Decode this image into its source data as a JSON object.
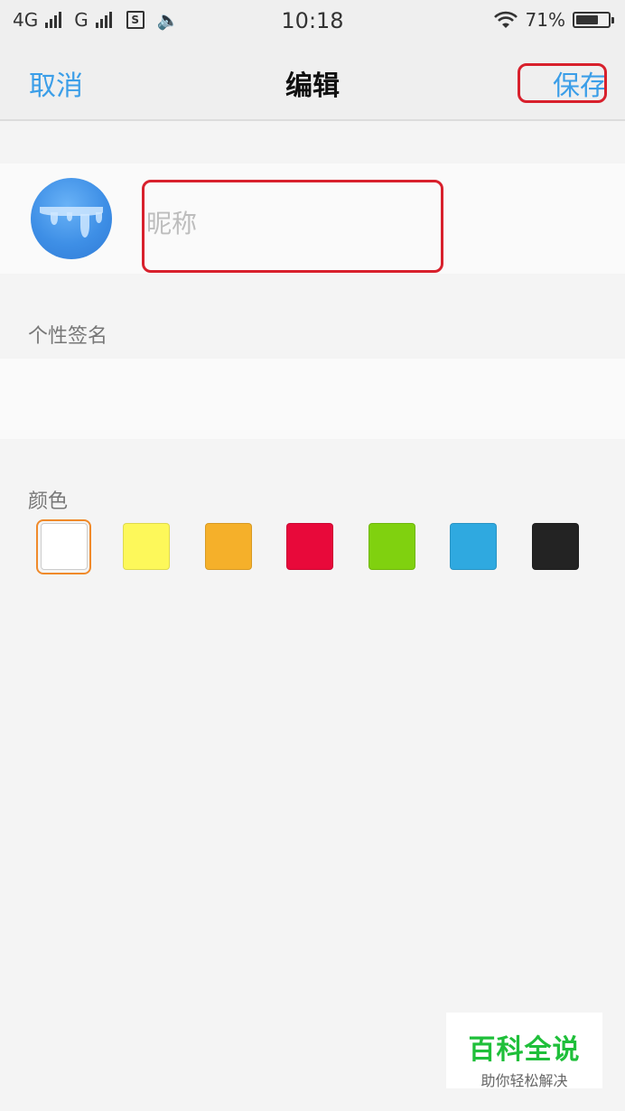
{
  "status_bar": {
    "network1": "4G",
    "network2": "G",
    "time": "10:18",
    "battery_percent": "71%",
    "battery_level": 0.71
  },
  "nav": {
    "cancel_label": "取消",
    "title": "编辑",
    "save_label": "保存"
  },
  "profile": {
    "nickname_placeholder": "昵称",
    "nickname_value": ""
  },
  "signature": {
    "label": "个性签名",
    "value": ""
  },
  "colors": {
    "label": "颜色",
    "swatches": [
      {
        "name": "white",
        "hex": "#ffffff",
        "selected": true
      },
      {
        "name": "yellow",
        "hex": "#fdf85a",
        "selected": false
      },
      {
        "name": "orange",
        "hex": "#f5b02a",
        "selected": false
      },
      {
        "name": "red",
        "hex": "#e8093a",
        "selected": false
      },
      {
        "name": "green",
        "hex": "#80d10f",
        "selected": false
      },
      {
        "name": "blue",
        "hex": "#2fa9e0",
        "selected": false
      },
      {
        "name": "black",
        "hex": "#232323",
        "selected": false
      }
    ]
  },
  "watermark": {
    "title": "百科全说",
    "subtitle": "助你轻松解决"
  },
  "theme": {
    "accent": "#3b9ee8",
    "highlight": "#d8202c",
    "selected_ring": "#f08a2a"
  }
}
